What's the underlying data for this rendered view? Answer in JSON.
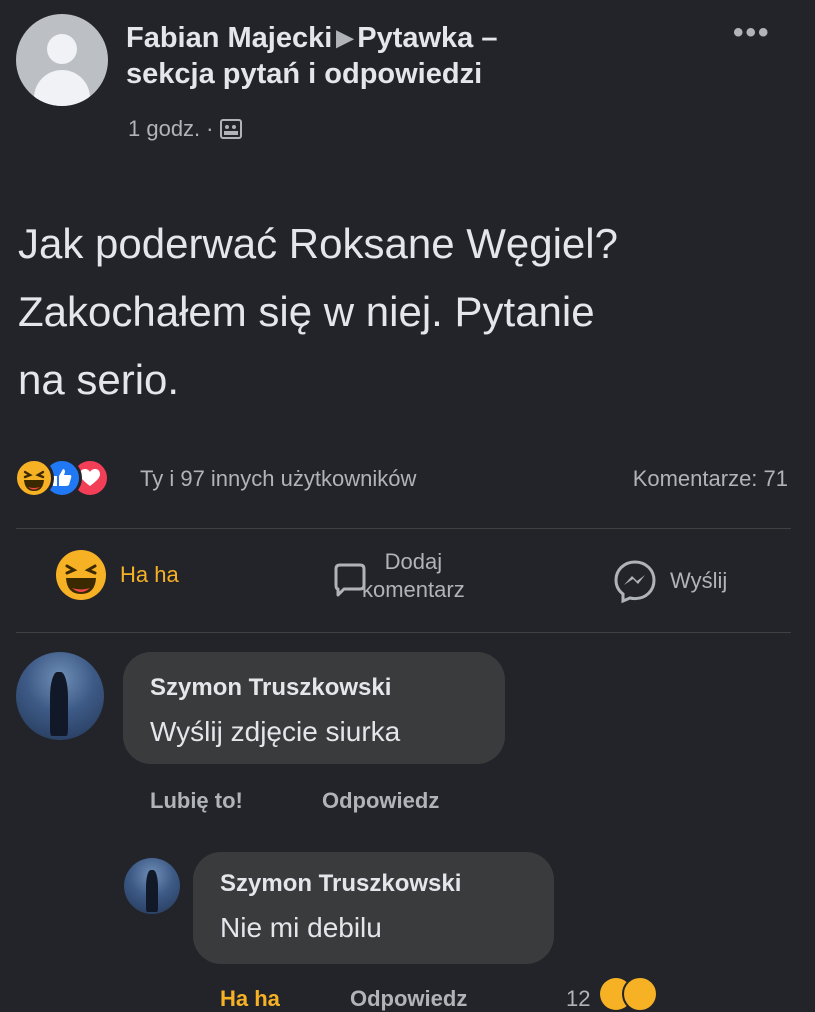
{
  "post": {
    "author": "Fabian Majecki",
    "group": "Pytawka –",
    "group_cont": "sekcja pytań i odpowiedzi",
    "time": "1 godz.",
    "time_sep": "·",
    "body_line1": "Jak poderwać Roksane Węgiel?",
    "body_line2": "Zakochałem się w niej. Pytanie",
    "body_line3": "na serio."
  },
  "reactions": {
    "summary": "Ty i 97 innych użytkowników",
    "comments_label": "Komentarze: 71",
    "icons": [
      "haha-icon",
      "like-icon",
      "love-icon"
    ]
  },
  "actions": {
    "haha": "Ha ha",
    "comment_line1": "Dodaj",
    "comment_line2": "komentarz",
    "send": "Wyślij"
  },
  "comments": [
    {
      "name": "Szymon Truszkowski",
      "text": "Wyślij zdjęcie siurka",
      "like": "Lubię to!",
      "reply": "Odpowiedz"
    },
    {
      "name": "Szymon Truszkowski",
      "text": "Nie mi debilu",
      "haha": "Ha ha",
      "reply": "Odpowiedz",
      "reaction_count": "12"
    }
  ],
  "colors": {
    "background": "#232429",
    "bubble": "#3a3b3c",
    "haha": "#f7b125",
    "like": "#2078f4",
    "love": "#f33e58"
  }
}
